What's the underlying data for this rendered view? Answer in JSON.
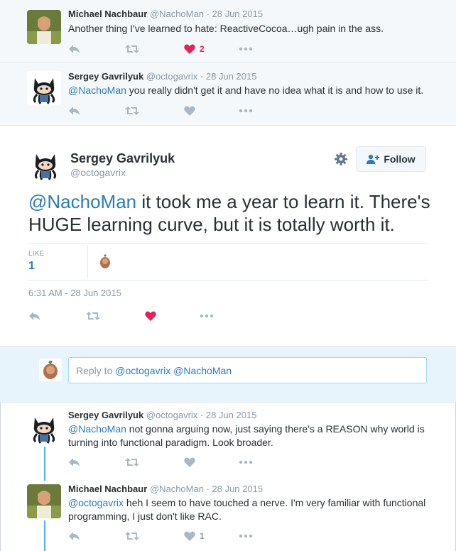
{
  "tweets_above": [
    {
      "name": "Michael Nachbaur",
      "meta": "@NachoMan · 28 Jun 2015",
      "text_plain": "Another thing I've learned to hate: ReactiveCocoa…ugh pain in the ass.",
      "like_count": "2"
    },
    {
      "name": "Sergey Gavrilyuk",
      "meta": "@octogavrix · 28 Jun 2015",
      "mention": "@NachoMan",
      "text_plain": " you really didn't get it and have no idea what it is and how to use it."
    }
  ],
  "main_tweet": {
    "name": "Sergey Gavrilyuk",
    "handle": "@octogavrix",
    "follow_label": "Follow",
    "mention": "@NachoMan",
    "text_plain": " it took me a year to learn it. There's HUGE learning curve, but it is totally worth it.",
    "like_label": "LIKE",
    "like_count": "1",
    "timestamp": "6:31 AM - 28 Jun 2015"
  },
  "reply_box": {
    "prefix": "Reply to ",
    "mentions": "@octogavrix @NachoMan"
  },
  "replies": [
    {
      "name": "Sergey Gavrilyuk",
      "meta": "@octogavrix · 28 Jun 2015",
      "mention": "@NachoMan",
      "line1_rest": " not gonna arguing now, just saying there's a REASON why world is",
      "line2": "turning into functional paradigm. Look broader."
    },
    {
      "name": "Michael Nachbaur",
      "meta": "@NachoMan · 28 Jun 2015",
      "mention": "@octogavrix",
      "line1_rest": " heh I seem to have touched a nerve. I'm very familiar with functional",
      "line2": "programming, I just don't like RAC.",
      "like_count": "1"
    }
  ],
  "colors": {
    "link": "#2b7bb9",
    "liked": "#e0245e",
    "action_gray": "#aab8c2",
    "thread_line": "#4ab3f4"
  },
  "icons": [
    "reply-icon",
    "retweet-icon",
    "heart-icon",
    "more-icon",
    "gear-icon",
    "follow-person-icon",
    "octocat-avatar",
    "photo-avatar"
  ]
}
